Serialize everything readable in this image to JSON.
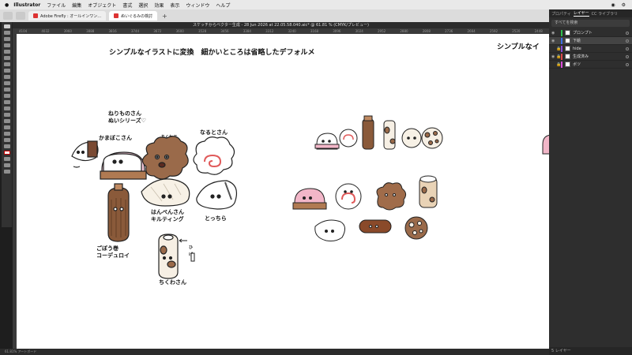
{
  "menubar": {
    "app": "Illustrator",
    "items": [
      "ファイル",
      "編集",
      "オブジェクト",
      "書式",
      "選択",
      "効果",
      "表示",
      "ウィンドウ",
      "ヘルプ"
    ]
  },
  "browser": {
    "tabs": [
      {
        "label": "Adobe Firefly : オールインワン..."
      },
      {
        "label": "ぬいぐるみの検討"
      }
    ],
    "new_tab": "+"
  },
  "document": {
    "title": "スケッチからベクター生成 - 28 Jun 2026 at 22.05.58.040.aic* @ 61.81 % (CMYK/プレビュー)",
    "ruler_ticks": [
      "4104",
      "4032",
      "3960",
      "3888",
      "3816",
      "3744",
      "3672",
      "3600",
      "3528",
      "3456",
      "3384",
      "3312",
      "3240",
      "3168",
      "3096",
      "3024",
      "2952",
      "2880",
      "2808",
      "2736",
      "2664",
      "2592",
      "2520",
      "2448"
    ],
    "status": "61.81%   アートボード"
  },
  "canvas": {
    "heading": "シンプルなイラストに変換　細かいところは省略したデフォルメ",
    "heading_right": "シンプルなイ",
    "labels": {
      "series": "ねりものさん\nぬいシリーズ♡",
      "kamaboko": "かまぼこさん",
      "chikuwabu": "ちくわぶ",
      "naruto": "なるとさん",
      "hanpen": "はんぺんさん\nキルティング",
      "totchi": "とっちら",
      "gobou": "ごぼう巻\nコーデュロイ",
      "chikuwa": "ちくわさん",
      "hige": "ひげ"
    }
  },
  "panel": {
    "tabs": [
      "プロパティ",
      "レイヤー",
      "CC ライブラリ"
    ],
    "active_tab": "レイヤー",
    "search": "すべてを検索",
    "layers": [
      {
        "name": "プロンプト",
        "color": "#2fbf4f"
      },
      {
        "name": "下絵",
        "color": "#3b6fe6"
      },
      {
        "name": "hide",
        "color": "#8a4bd9"
      },
      {
        "name": "生成済み",
        "color": "#e04848"
      },
      {
        "name": "ボツ",
        "color": "#d94bd9"
      }
    ],
    "footer": "5 レイヤー"
  }
}
